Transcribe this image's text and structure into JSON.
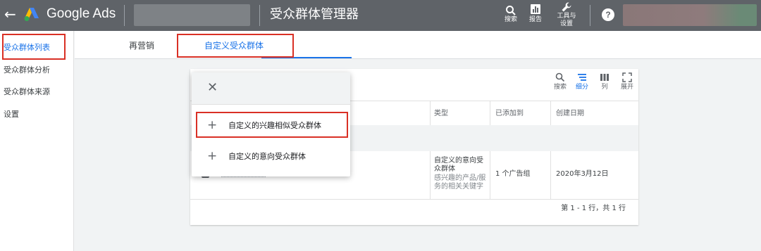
{
  "header": {
    "brand": "Google Ads",
    "title": "受众群体管理器",
    "search_label": "搜索",
    "reports_label": "报告",
    "tools_label_line1": "工具与",
    "tools_label_line2": "设置"
  },
  "sidebar": {
    "items": [
      {
        "label": "受众群体列表"
      },
      {
        "label": "受众群体分析"
      },
      {
        "label": "受众群体来源"
      },
      {
        "label": "设置"
      }
    ]
  },
  "tabs": [
    {
      "label": "再营销"
    },
    {
      "label": "自定义受众群体"
    }
  ],
  "card_toolbar": {
    "search": "搜索",
    "segment": "细分",
    "columns": "列",
    "expand": "展开"
  },
  "table": {
    "headers": [
      "类型",
      "已添加到",
      "创建日期"
    ],
    "row": {
      "type_line1": "自定义的意向受",
      "type_line2": "众群体",
      "desc_line1": "感兴趣的产品/服",
      "desc_line2": "务的相关关键字",
      "added_to": "1 个广告组",
      "created": "2020年3月12日"
    },
    "pagination": "第 1 - 1 行，共 1 行"
  },
  "popup": {
    "items": [
      {
        "label": "自定义的兴趣相似受众群体"
      },
      {
        "label": "自定义的意向受众群体"
      }
    ]
  },
  "colors": {
    "topbar": "#5f6368",
    "accent": "#1a73e8",
    "highlight": "#d93025"
  }
}
